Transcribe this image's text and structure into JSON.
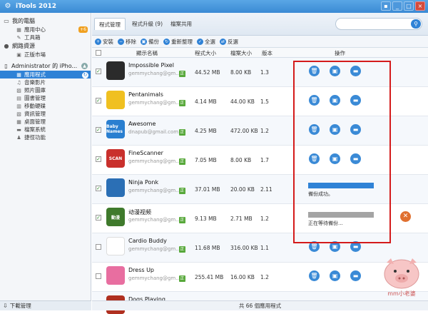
{
  "window": {
    "title": "iTools 2012",
    "logo_icon": "bicycle-icon"
  },
  "sidebar": {
    "my_computer": "我的電腦",
    "app_center": "應用中心",
    "app_center_badge": "+6",
    "toolbox": "工具箱",
    "network": "網路資源",
    "market": "正版市場",
    "device": "Administrator 的 iPho...",
    "items": [
      {
        "label": "應用程式",
        "icon": "apps-icon"
      },
      {
        "label": "音樂影片",
        "icon": "music-icon"
      },
      {
        "label": "照片圖庫",
        "icon": "photo-icon"
      },
      {
        "label": "圖書管理",
        "icon": "book-icon"
      },
      {
        "label": "移動硬碟",
        "icon": "disk-icon"
      },
      {
        "label": "資訊管理",
        "icon": "info-icon"
      },
      {
        "label": "桌面管理",
        "icon": "desktop-icon"
      },
      {
        "label": "檔案系統",
        "icon": "folder-icon"
      },
      {
        "label": "捷徑功能",
        "icon": "shortcut-icon"
      }
    ],
    "download": "下載管理"
  },
  "tabs": [
    "程式管理",
    "程式升級 (9)",
    "檔案共用"
  ],
  "toolbar": [
    "安裝",
    "移除",
    "備份",
    "重新整理",
    "全選",
    "反選"
  ],
  "table": {
    "headers": {
      "name": "顯示名稱",
      "size": "程式大小",
      "doc_size": "檔案大小",
      "version": "版本",
      "ops": "操作"
    },
    "rows": [
      {
        "name": "Impossible Pixel",
        "dev": "gemmychang@gm...",
        "tag": "正",
        "size": "44.52 MB",
        "doc": "8.00 KB",
        "ver": "1.3",
        "checked": "✓",
        "color": "#2b2b2b",
        "icon_text": "",
        "state": "ops"
      },
      {
        "name": "Pentanimals",
        "dev": "gemmychang@gm...",
        "tag": "正",
        "size": "4.14 MB",
        "doc": "44.00 KB",
        "ver": "1.5",
        "checked": "✓",
        "color": "#f0c020",
        "icon_text": "",
        "state": "ops"
      },
      {
        "name": "Awesome",
        "dev": "dnapub@gmail.com",
        "tag": "正",
        "size": "4.25 MB",
        "doc": "472.00 KB",
        "ver": "1.2",
        "checked": "✓",
        "color": "#2a7fd0",
        "icon_text": "Baby Names",
        "state": "ops"
      },
      {
        "name": "FineScanner",
        "dev": "gemmychang@gm...",
        "tag": "正",
        "size": "7.05 MB",
        "doc": "8.00 KB",
        "ver": "1.7",
        "checked": "✓",
        "color": "#c9302c",
        "icon_text": "SCAN",
        "state": "ops"
      },
      {
        "name": "Ninja Ponk",
        "dev": "gemmychang@gm...",
        "tag": "正",
        "size": "37.01 MB",
        "doc": "20.00 KB",
        "ver": "2.11",
        "checked": "✓",
        "color": "#2b6fb5",
        "icon_text": "",
        "state": "done",
        "status": "備份成功。"
      },
      {
        "name": "动漫视频",
        "dev": "gemmychang@gm...",
        "tag": "正",
        "size": "9.13 MB",
        "doc": "2.71 MB",
        "ver": "1.2",
        "checked": "✓",
        "color": "#3f7a2c",
        "icon_text": "動漫",
        "state": "waiting",
        "status": "正在等待備份..."
      },
      {
        "name": "Cardio Buddy",
        "dev": "gemmychang@gm...",
        "tag": "正",
        "size": "11.68 MB",
        "doc": "316.00 KB",
        "ver": "1.1",
        "checked": "",
        "color": "#ffffff",
        "icon_text": "",
        "state": "ops"
      },
      {
        "name": "Dress Up",
        "dev": "gemmychang@gm...",
        "tag": "正",
        "size": "255.41 MB",
        "doc": "16.00 KB",
        "ver": "1.2",
        "checked": "",
        "color": "#e86ea0",
        "icon_text": "",
        "state": "ops"
      },
      {
        "name": "Dogs Playing",
        "dev": "",
        "tag": "",
        "size": "",
        "doc": "",
        "ver": "",
        "checked": "",
        "color": "#b03020",
        "icon_text": "",
        "state": "none"
      }
    ]
  },
  "footer": "共 66 個應用程式",
  "watermark": "mm小老婆"
}
